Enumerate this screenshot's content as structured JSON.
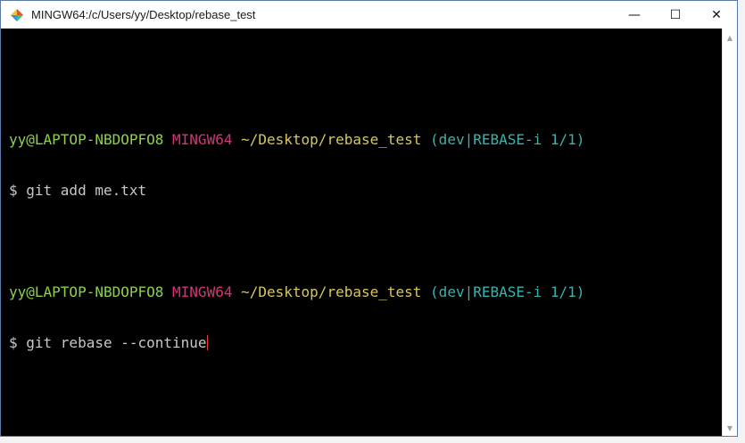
{
  "window": {
    "title": "MINGW64:/c/Users/yy/Desktop/rebase_test",
    "controls": {
      "minimize": "—",
      "maximize": "☐",
      "close": "✕"
    }
  },
  "terminal": {
    "prompt1": {
      "user_host": "yy@LAPTOP-NBDOPFO8",
      "system": "MINGW64",
      "path": "~/Desktop/rebase_test",
      "branch": "(dev|REBASE-i 1/1)"
    },
    "cmd1": "$ git add me.txt",
    "prompt2": {
      "user_host": "yy@LAPTOP-NBDOPFO8",
      "system": "MINGW64",
      "path": "~/Desktop/rebase_test",
      "branch": "(dev|REBASE-i 1/1)"
    },
    "cmd2": "$ git rebase --continue"
  },
  "scrollbar": {
    "up_icon": "▲",
    "down_icon": "▼"
  },
  "colors": {
    "user_host": "#8bd14a",
    "system": "#d6347a",
    "path": "#d7c85c",
    "branch": "#3ab3ad",
    "cursor": "#e0413b"
  }
}
